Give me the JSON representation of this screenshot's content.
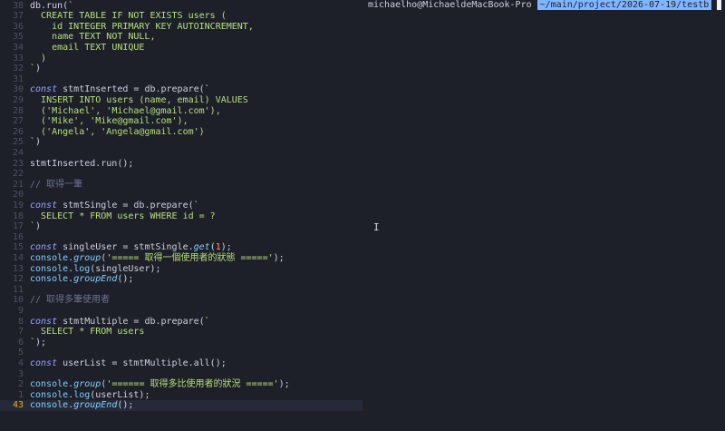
{
  "editor": {
    "current_line": 43,
    "lines": [
      {
        "n": "38",
        "segs": [
          [
            "p",
            "db.run(`"
          ]
        ]
      },
      {
        "n": "37",
        "segs": [
          [
            "g",
            "  "
          ],
          [
            "s",
            "CREATE TABLE IF NOT EXISTS users ("
          ]
        ]
      },
      {
        "n": "36",
        "segs": [
          [
            "g",
            "  "
          ],
          [
            "s",
            "  id INTEGER PRIMARY KEY AUTOINCREMENT,"
          ]
        ]
      },
      {
        "n": "35",
        "segs": [
          [
            "g",
            "  "
          ],
          [
            "s",
            "  name TEXT NOT NULL,"
          ]
        ]
      },
      {
        "n": "34",
        "segs": [
          [
            "g",
            "  "
          ],
          [
            "s",
            "  email TEXT UNIQUE"
          ]
        ]
      },
      {
        "n": "33",
        "segs": [
          [
            "g",
            "  "
          ],
          [
            "s",
            ")"
          ]
        ]
      },
      {
        "n": "32",
        "segs": [
          [
            "s",
            "`"
          ],
          [
            "p",
            ")"
          ]
        ]
      },
      {
        "n": "31",
        "segs": []
      },
      {
        "n": "30",
        "segs": [
          [
            "k",
            "const"
          ],
          [
            "p",
            " stmtInserted = db.prepare("
          ],
          [
            "s",
            "`"
          ]
        ]
      },
      {
        "n": "29",
        "segs": [
          [
            "g",
            "  "
          ],
          [
            "s",
            "INSERT INTO users (name, email) VALUES"
          ]
        ]
      },
      {
        "n": "28",
        "segs": [
          [
            "g",
            "  "
          ],
          [
            "s",
            "('Michael', 'Michael@gmail.com'),"
          ]
        ]
      },
      {
        "n": "27",
        "segs": [
          [
            "g",
            "  "
          ],
          [
            "s",
            "('Mike', 'Mike@gmail.com'),"
          ]
        ]
      },
      {
        "n": "26",
        "segs": [
          [
            "g",
            "  "
          ],
          [
            "s",
            "('Angela', 'Angela@gmail.com')"
          ]
        ]
      },
      {
        "n": "25",
        "segs": [
          [
            "s",
            "`"
          ],
          [
            "p",
            ")"
          ]
        ]
      },
      {
        "n": "24",
        "segs": []
      },
      {
        "n": "23",
        "segs": [
          [
            "p",
            "stmtInserted.run();"
          ]
        ]
      },
      {
        "n": "22",
        "segs": []
      },
      {
        "n": "21",
        "segs": [
          [
            "c",
            "// 取得一筆"
          ]
        ]
      },
      {
        "n": "20",
        "segs": []
      },
      {
        "n": "19",
        "segs": [
          [
            "k",
            "const"
          ],
          [
            "p",
            " stmtSingle = db.prepare("
          ],
          [
            "s",
            "`"
          ]
        ]
      },
      {
        "n": "18",
        "segs": [
          [
            "g",
            "  "
          ],
          [
            "s",
            "SELECT * FROM users WHERE id = ?"
          ]
        ]
      },
      {
        "n": "17",
        "segs": [
          [
            "s",
            "`"
          ],
          [
            "p",
            ")"
          ]
        ]
      },
      {
        "n": "16",
        "segs": []
      },
      {
        "n": "15",
        "segs": [
          [
            "k",
            "const"
          ],
          [
            "p",
            " singleUser = stmtSingle."
          ],
          [
            "fi",
            "get"
          ],
          [
            "p",
            "("
          ],
          [
            "n",
            "1"
          ],
          [
            "p",
            ");"
          ]
        ]
      },
      {
        "n": "14",
        "segs": [
          [
            "f",
            "console"
          ],
          [
            "p",
            "."
          ],
          [
            "fi",
            "group"
          ],
          [
            "p",
            "("
          ],
          [
            "s",
            "'===== 取得一個使用者的狀態 ====='"
          ],
          [
            "p",
            ");"
          ]
        ]
      },
      {
        "n": "13",
        "segs": [
          [
            "f",
            "console"
          ],
          [
            "p",
            "."
          ],
          [
            "f",
            "log"
          ],
          [
            "p",
            "(singleUser);"
          ]
        ]
      },
      {
        "n": "12",
        "segs": [
          [
            "f",
            "console"
          ],
          [
            "p",
            "."
          ],
          [
            "fi",
            "groupEnd"
          ],
          [
            "p",
            "();"
          ]
        ]
      },
      {
        "n": "11",
        "segs": []
      },
      {
        "n": "10",
        "segs": [
          [
            "c",
            "// 取得多筆使用者"
          ]
        ]
      },
      {
        "n": "9",
        "segs": []
      },
      {
        "n": "8",
        "segs": [
          [
            "k",
            "const"
          ],
          [
            "p",
            " stmtMultiple = db.prepare("
          ],
          [
            "s",
            "`"
          ]
        ]
      },
      {
        "n": "7",
        "segs": [
          [
            "g",
            "  "
          ],
          [
            "s",
            "SELECT * FROM users"
          ]
        ]
      },
      {
        "n": "6",
        "segs": [
          [
            "s",
            "`"
          ],
          [
            "p",
            ");"
          ]
        ]
      },
      {
        "n": "5",
        "segs": []
      },
      {
        "n": "4",
        "segs": [
          [
            "k",
            "const"
          ],
          [
            "p",
            " userList = stmtMultiple.all();"
          ]
        ]
      },
      {
        "n": "3",
        "segs": []
      },
      {
        "n": "2",
        "segs": [
          [
            "f",
            "console"
          ],
          [
            "p",
            "."
          ],
          [
            "fi",
            "group"
          ],
          [
            "p",
            "("
          ],
          [
            "s",
            "'====== 取得多比使用者的狀況 ====='"
          ],
          [
            "p",
            ");"
          ]
        ]
      },
      {
        "n": "1",
        "segs": [
          [
            "f",
            "console"
          ],
          [
            "p",
            "."
          ],
          [
            "f",
            "log"
          ],
          [
            "p",
            "(userList);"
          ]
        ]
      },
      {
        "n": "43",
        "segs": [
          [
            "f",
            "console"
          ],
          [
            "p",
            "."
          ],
          [
            "fi",
            "groupEnd"
          ],
          [
            "p",
            "();"
          ]
        ]
      }
    ]
  },
  "terminal": {
    "host": "michaelho@MichaeldeMacBook-Pro",
    "path": "~/main/project/2026-07-19/testb"
  },
  "colors": {
    "background": "#1d1f29",
    "keyword": "#9aa5ff",
    "string": "#b7e07c",
    "function": "#7fd1ff",
    "number": "#ff9e64",
    "comment": "#6b7394",
    "current_line_number": "#f5a623",
    "path_badge": "#7fb6ff"
  },
  "icons": {
    "mouse_cursor": "i-beam-cursor-icon"
  }
}
